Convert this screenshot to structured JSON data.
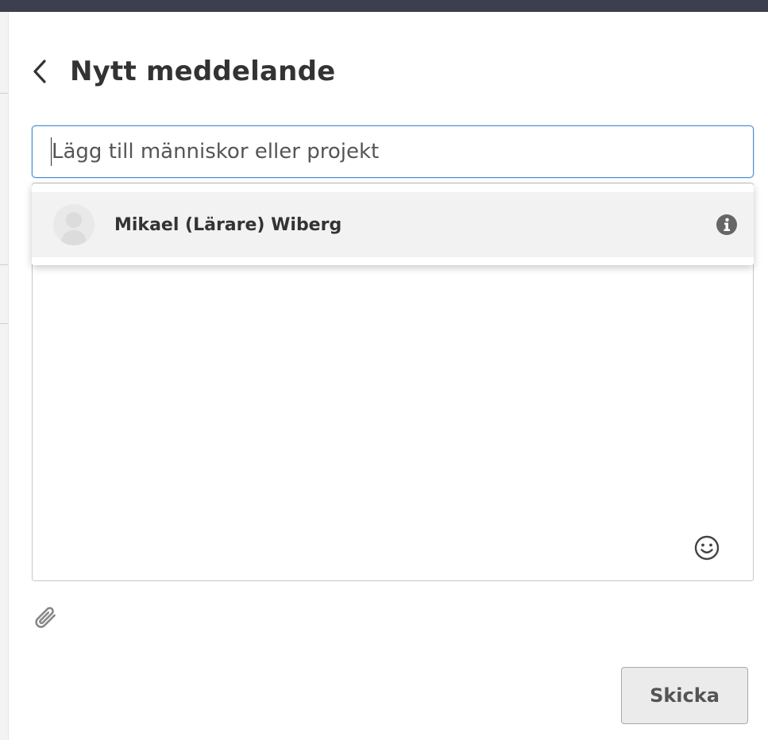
{
  "header": {
    "title": "Nytt meddelande",
    "back_icon": "chevron-left-icon"
  },
  "recipient": {
    "placeholder": "Lägg till människor eller projekt",
    "value": ""
  },
  "suggestions": [
    {
      "name": "Mikael (Lärare) Wiberg",
      "avatar_icon": "default-avatar-icon",
      "info_icon": "info-circle-icon"
    }
  ],
  "message": {
    "value": "",
    "emoji_icon": "smiley-icon"
  },
  "attachment": {
    "icon": "paperclip-icon"
  },
  "actions": {
    "send_label": "Skicka"
  },
  "colors": {
    "top_bar": "#3c3f4e",
    "focus_border": "#4a90d9",
    "suggestion_bg": "#f2f2f2",
    "send_button_bg": "#ebebeb"
  }
}
